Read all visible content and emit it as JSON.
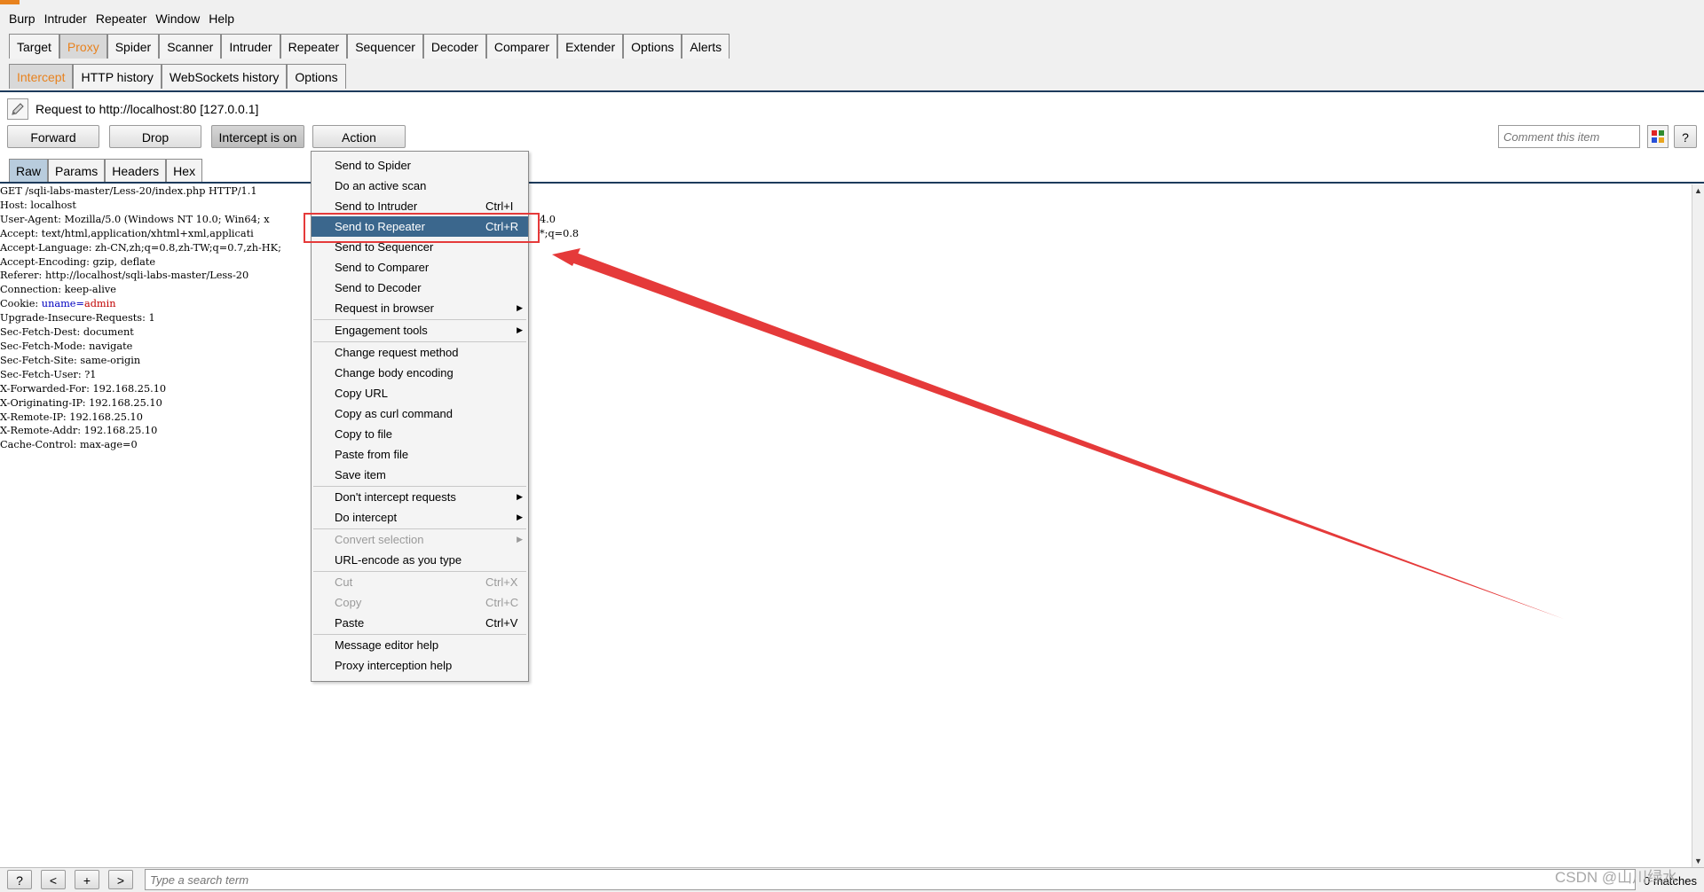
{
  "menubar": [
    "Burp",
    "Intruder",
    "Repeater",
    "Window",
    "Help"
  ],
  "main_tabs": [
    {
      "label": "Target"
    },
    {
      "label": "Proxy",
      "active": true
    },
    {
      "label": "Spider"
    },
    {
      "label": "Scanner"
    },
    {
      "label": "Intruder"
    },
    {
      "label": "Repeater"
    },
    {
      "label": "Sequencer"
    },
    {
      "label": "Decoder"
    },
    {
      "label": "Comparer"
    },
    {
      "label": "Extender"
    },
    {
      "label": "Options"
    },
    {
      "label": "Alerts"
    }
  ],
  "sub_tabs": [
    {
      "label": "Intercept",
      "active": true
    },
    {
      "label": "HTTP history"
    },
    {
      "label": "WebSockets history"
    },
    {
      "label": "Options"
    }
  ],
  "request": {
    "label": "Request to http://localhost:80  [127.0.0.1]"
  },
  "toolbar": {
    "forward": "Forward",
    "drop": "Drop",
    "intercept": "Intercept is on",
    "action": "Action",
    "comment_placeholder": "Comment this item",
    "help": "?"
  },
  "editor_tabs": [
    {
      "label": "Raw",
      "active": true
    },
    {
      "label": "Params"
    },
    {
      "label": "Headers"
    },
    {
      "label": "Hex"
    }
  ],
  "editor_lines": [
    {
      "text": "GET /sqli-labs-master/Less-20/index.php HTTP/1.1"
    },
    {
      "text": "Host: localhost"
    },
    {
      "text": "User-Agent: Mozilla/5.0 (Windows NT 10.0; Win64; x",
      "tail": "4.0"
    },
    {
      "text": "Accept: text/html,application/xhtml+xml,applicati",
      "tail": "*;q=0.8"
    },
    {
      "text": "Accept-Language: zh-CN,zh;q=0.8,zh-TW;q=0.7,zh-HK;"
    },
    {
      "text": "Accept-Encoding: gzip, deflate"
    },
    {
      "text": "Referer: http://localhost/sqli-labs-master/Less-20"
    },
    {
      "text": "Connection: keep-alive"
    },
    {
      "text": "Cookie: ",
      "param_name": "uname",
      "eq": "=",
      "param_val": "admin"
    },
    {
      "text": "Upgrade-Insecure-Requests: 1"
    },
    {
      "text": "Sec-Fetch-Dest: document"
    },
    {
      "text": "Sec-Fetch-Mode: navigate"
    },
    {
      "text": "Sec-Fetch-Site: same-origin"
    },
    {
      "text": "Sec-Fetch-User: ?1"
    },
    {
      "text": "X-Forwarded-For: 192.168.25.10"
    },
    {
      "text": "X-Originating-IP: 192.168.25.10"
    },
    {
      "text": "X-Remote-IP: 192.168.25.10"
    },
    {
      "text": "X-Remote-Addr: 192.168.25.10"
    },
    {
      "text": "Cache-Control: max-age=0"
    }
  ],
  "context_menu": [
    {
      "label": "Send to Spider"
    },
    {
      "label": "Do an active scan"
    },
    {
      "label": "Send to Intruder",
      "shortcut": "Ctrl+I"
    },
    {
      "label": "Send to Repeater",
      "shortcut": "Ctrl+R",
      "selected": true
    },
    {
      "label": "Send to Sequencer"
    },
    {
      "label": "Send to Comparer"
    },
    {
      "label": "Send to Decoder"
    },
    {
      "label": "Request in browser",
      "submenu": true
    },
    {
      "label": "Engagement tools",
      "submenu": true,
      "sep_before": true
    },
    {
      "label": "Change request method",
      "sep_before": true
    },
    {
      "label": "Change body encoding"
    },
    {
      "label": "Copy URL"
    },
    {
      "label": "Copy as curl command"
    },
    {
      "label": "Copy to file"
    },
    {
      "label": "Paste from file"
    },
    {
      "label": "Save item"
    },
    {
      "label": "Don't intercept requests",
      "submenu": true,
      "sep_before": true
    },
    {
      "label": "Do intercept",
      "submenu": true
    },
    {
      "label": "Convert selection",
      "submenu": true,
      "disabled": true,
      "sep_before": true
    },
    {
      "label": "URL-encode as you type"
    },
    {
      "label": "Cut",
      "shortcut": "Ctrl+X",
      "disabled": true,
      "sep_before": true
    },
    {
      "label": "Copy",
      "shortcut": "Ctrl+C",
      "disabled": true
    },
    {
      "label": "Paste",
      "shortcut": "Ctrl+V"
    },
    {
      "label": "Message editor help",
      "sep_before": true
    },
    {
      "label": "Proxy interception help"
    }
  ],
  "bottom": {
    "help": "?",
    "prev": "<",
    "add": "+",
    "next": ">",
    "search_placeholder": "Type a search term",
    "matches": "0 matches"
  },
  "watermark": "CSDN @山川绿水",
  "colors": {
    "accent": "#e8821e",
    "selection": "#3b678d",
    "annotation": "#e53a3a",
    "param_name": "#0000c0",
    "param_value": "#c00000"
  }
}
